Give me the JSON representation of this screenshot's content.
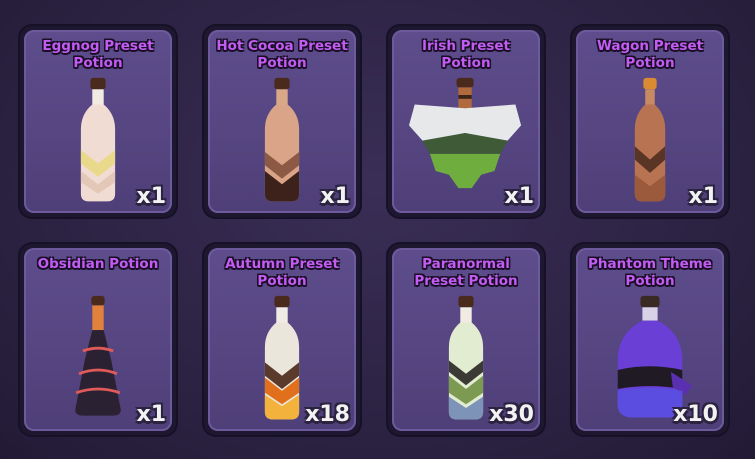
{
  "inventory": {
    "items": [
      {
        "name": "Eggnog Preset Potion",
        "count": "x1",
        "icon": "eggnog-potion-icon"
      },
      {
        "name": "Hot Cocoa Preset Potion",
        "count": "x1",
        "icon": "hot-cocoa-potion-icon"
      },
      {
        "name": "Irish Preset Potion",
        "count": "x1",
        "icon": "irish-potion-icon"
      },
      {
        "name": "Wagon Preset Potion",
        "count": "x1",
        "icon": "wagon-potion-icon"
      },
      {
        "name": "Obsidian Potion",
        "count": "x1",
        "icon": "obsidian-potion-icon"
      },
      {
        "name": "Autumn Preset Potion",
        "count": "x18",
        "icon": "autumn-potion-icon"
      },
      {
        "name": "Paranormal Preset Potion",
        "count": "x30",
        "icon": "paranormal-potion-icon"
      },
      {
        "name": "Phantom Theme Potion",
        "count": "x10",
        "icon": "phantom-potion-icon"
      }
    ]
  },
  "colors": {
    "title": "#c25cf2",
    "card": "#5e4d8c",
    "count": "#f2f2f2"
  }
}
